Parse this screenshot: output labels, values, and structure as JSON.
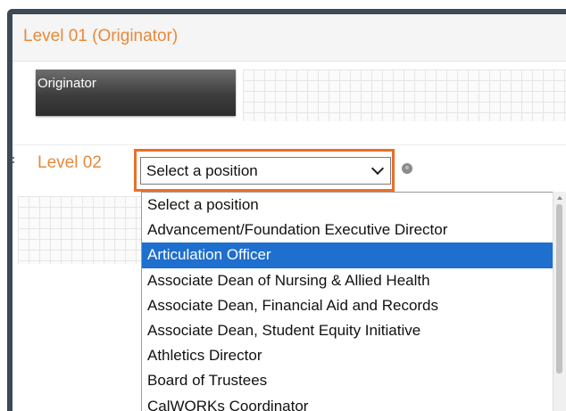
{
  "level1": {
    "title": "Level 01 (Originator)",
    "originator_label": "Originator"
  },
  "level2": {
    "title": "Level 02",
    "select_value": "Select a position"
  },
  "dropdown": {
    "selected_index": 2,
    "options": [
      "Select a position",
      "Advancement/Foundation Executive Director",
      "Articulation Officer",
      "Associate Dean of Nursing & Allied Health",
      "Associate Dean, Financial Aid and Records",
      "Associate Dean, Student Equity Initiative",
      "Athletics Director",
      "Board of Trustees",
      "CalWORKs Coordinator"
    ]
  },
  "colors": {
    "level_title": "#e8893a",
    "highlight_border": "#e8702a",
    "selected_option": "#1e6fce"
  }
}
